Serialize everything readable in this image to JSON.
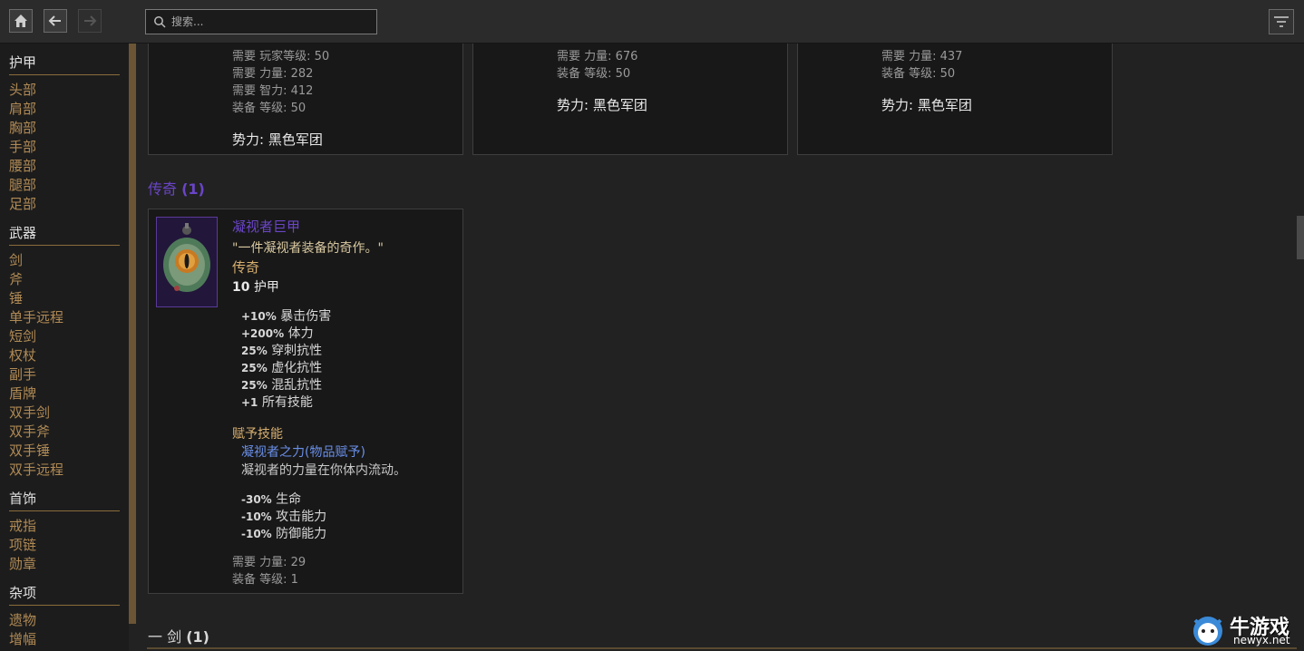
{
  "search": {
    "placeholder": "搜索..."
  },
  "sidebar": {
    "categories": [
      {
        "title": "护甲",
        "items": [
          "头部",
          "肩部",
          "胸部",
          "手部",
          "腰部",
          "腿部",
          "足部"
        ]
      },
      {
        "title": "武器",
        "items": [
          "剑",
          "斧",
          "锤",
          "单手远程",
          "短剑",
          "权杖",
          "副手",
          "盾牌",
          "双手剑",
          "双手斧",
          "双手锤",
          "双手远程"
        ]
      },
      {
        "title": "首饰",
        "items": [
          "戒指",
          "项链",
          "勋章"
        ]
      },
      {
        "title": "杂项",
        "items": [
          "遗物",
          "增幅"
        ]
      }
    ]
  },
  "cards_top": [
    {
      "lines": [
        "需要 玩家等级: 50",
        "需要 力量: 282",
        "需要 智力: 412",
        "装备 等级: 50"
      ],
      "faction": "势力: 黑色军团"
    },
    {
      "lines": [
        "需要 力量: 676",
        "装备 等级: 50"
      ],
      "faction": "势力: 黑色军团"
    },
    {
      "lines": [
        "需要 力量: 437",
        "装备 等级: 50"
      ],
      "faction": "势力: 黑色军团"
    }
  ],
  "legendary_section": {
    "title": "传奇",
    "count": "(1)"
  },
  "legend_item": {
    "name": "凝视者巨甲",
    "flavor": "\"一件凝视者装备的奇作。\"",
    "rarity": "传奇",
    "armor_value": "10",
    "armor_label": "护甲",
    "stats": [
      {
        "value": "+10%",
        "label": "暴击伤害"
      },
      {
        "value": "+200%",
        "label": "体力"
      },
      {
        "value": "25%",
        "label": "穿刺抗性"
      },
      {
        "value": "25%",
        "label": "虚化抗性"
      },
      {
        "value": "25%",
        "label": "混乱抗性"
      },
      {
        "value": "+1",
        "label": "所有技能"
      }
    ],
    "skill_header": "赋予技能",
    "skill_name": "凝视者之力(物品赋予)",
    "skill_desc": "凝视者的力量在你体内流动。",
    "skill_stats": [
      {
        "value": "-30%",
        "label": "生命"
      },
      {
        "value": "-10%",
        "label": "攻击能力"
      },
      {
        "value": "-10%",
        "label": "防御能力"
      }
    ],
    "requirements": [
      "需要 力量: 29",
      "装备 等级: 1"
    ]
  },
  "sword_section": {
    "title": "一 剑",
    "count": "(1)"
  },
  "logo": {
    "name": "牛游戏",
    "url_text": "newyx.net"
  },
  "colors": {
    "accent": "#b08a55",
    "legendary": "#6a45c8",
    "skill": "#6a8fe8"
  }
}
